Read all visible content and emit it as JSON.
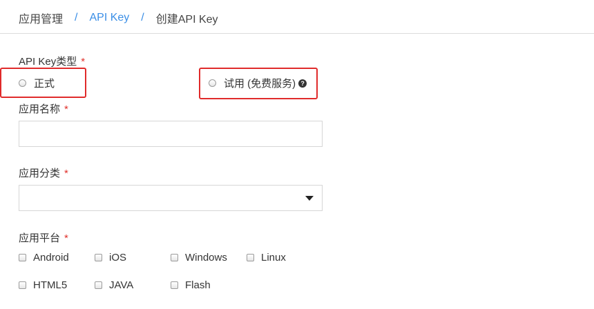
{
  "breadcrumb": {
    "items": [
      "应用管理",
      "API Key",
      "创建API Key"
    ],
    "separator": "/"
  },
  "form": {
    "api_key_type": {
      "label": "API Key类型",
      "required_mark": "*",
      "options": [
        "正式",
        "试用 (免费服务)"
      ],
      "help_icon": "question-circle-icon"
    },
    "app_name": {
      "label": "应用名称",
      "required_mark": "*",
      "value": ""
    },
    "app_category": {
      "label": "应用分类",
      "required_mark": "*",
      "value": ""
    },
    "app_platform": {
      "label": "应用平台",
      "required_mark": "*",
      "options": [
        "Android",
        "iOS",
        "Windows",
        "Linux",
        "HTML5",
        "JAVA",
        "Flash"
      ]
    }
  },
  "colors": {
    "link": "#3a8ee6",
    "required": "#e0312b",
    "highlight": "#e02a2a"
  }
}
